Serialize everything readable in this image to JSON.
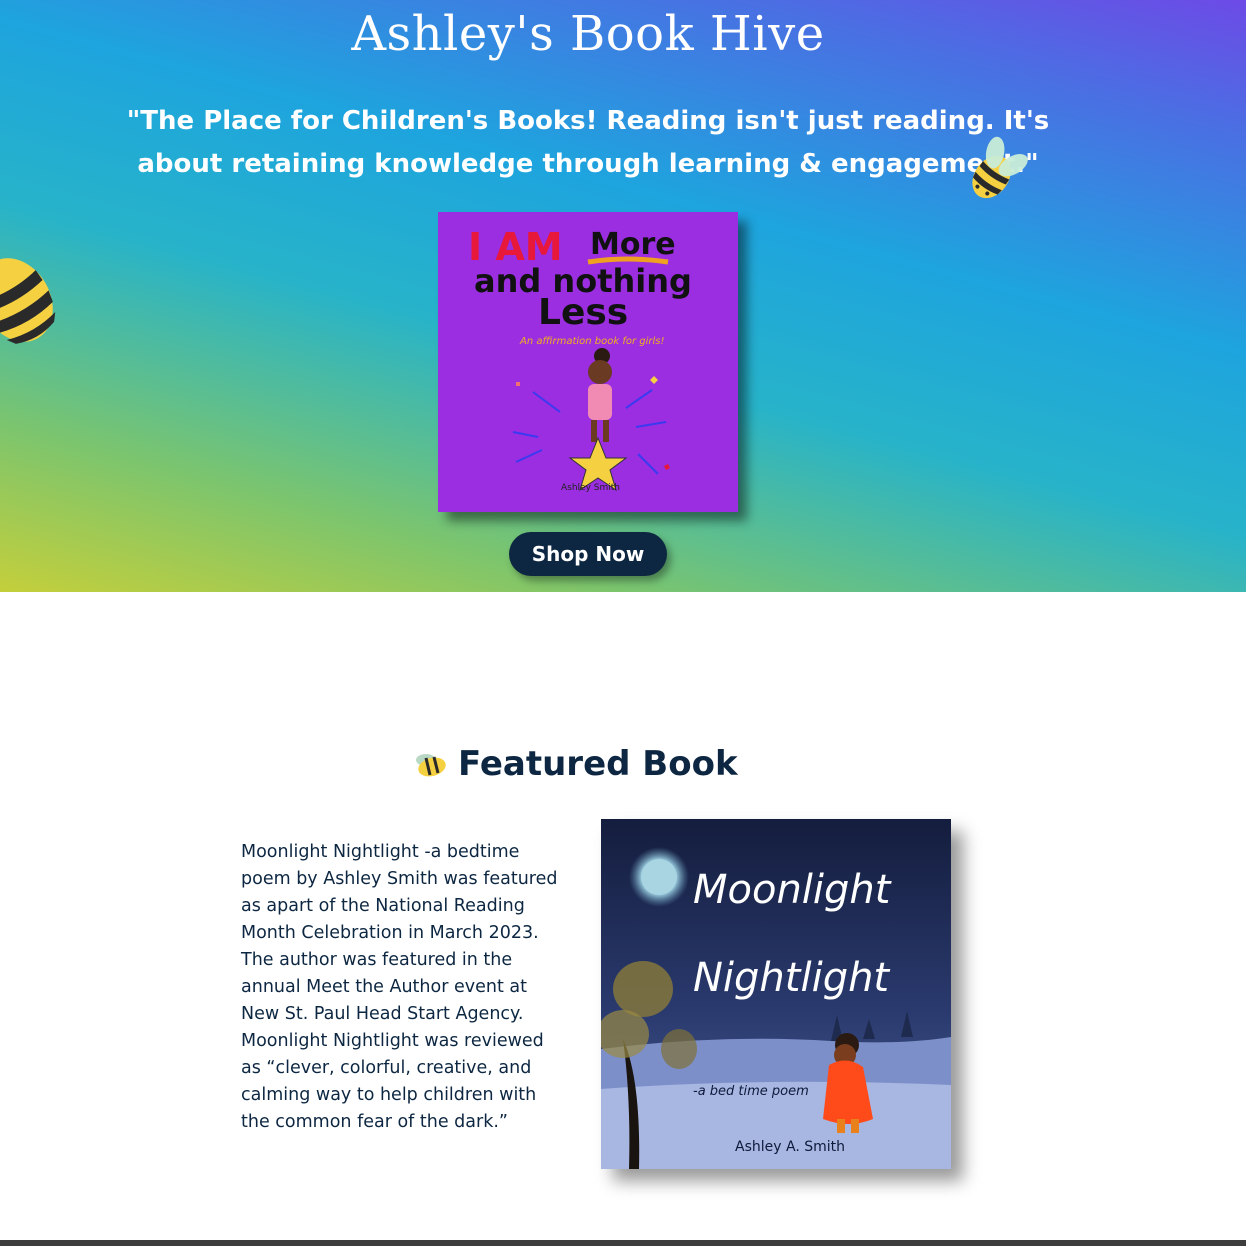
{
  "hero": {
    "site_title": "Ashley's Book Hive",
    "tagline": "\"The Place for Children's Books! Reading isn't just reading. It's about retaining knowledge through learning & engagement.\"",
    "cover": {
      "line1_a": "I AM",
      "line1_b": "More",
      "line2": "and nothing",
      "line3": "Less",
      "subtitle": "An affirmation book for girls!",
      "author": "Ashley Smith"
    },
    "shop_button": "Shop Now"
  },
  "featured": {
    "heading": "Featured Book",
    "description": "Moonlight Nightlight -a bedtime poem by Ashley Smith was featured as apart of the National Reading Month Celebration in March 2023. The author was featured in the annual Meet the Author event at New St. Paul Head Start Agency. Moonlight Nightlight was reviewed as “clever, colorful, creative, and calming way to help children with the common fear of the dark.”",
    "cover": {
      "title_line1": "Moonlight",
      "title_line2": "Nightlight",
      "subtitle": "-a bed time poem",
      "author": "Ashley A. Smith"
    }
  },
  "icons": [
    "bee-icon"
  ],
  "colors": {
    "navy": "#0d2742",
    "purple_cover": "#9a2ee0",
    "bee_yellow": "#f5d142"
  }
}
